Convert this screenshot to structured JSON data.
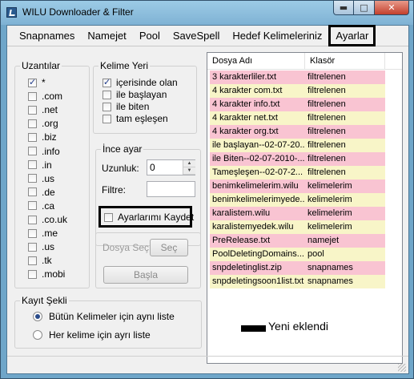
{
  "window": {
    "title": "WILU Downloader & Filter"
  },
  "menu": [
    "Snapnames",
    "Namejet",
    "Pool",
    "SaveSpell",
    "Hedef Kelimeleriniz",
    "Ayarlar"
  ],
  "extensions": {
    "legend": "Uzantılar",
    "items": [
      {
        "label": "*",
        "checked": true
      },
      {
        "label": ".com",
        "checked": false
      },
      {
        "label": ".net",
        "checked": false
      },
      {
        "label": ".org",
        "checked": false
      },
      {
        "label": ".biz",
        "checked": false
      },
      {
        "label": ".info",
        "checked": false
      },
      {
        "label": ".in",
        "checked": false
      },
      {
        "label": ".us",
        "checked": false
      },
      {
        "label": ".de",
        "checked": false
      },
      {
        "label": ".ca",
        "checked": false
      },
      {
        "label": ".co.uk",
        "checked": false
      },
      {
        "label": ".me",
        "checked": false
      },
      {
        "label": ".us",
        "checked": false
      },
      {
        "label": ".tk",
        "checked": false
      },
      {
        "label": ".mobi",
        "checked": false
      }
    ]
  },
  "word_position": {
    "legend": "Kelime Yeri",
    "items": [
      {
        "label": "içerisinde olan",
        "checked": true
      },
      {
        "label": "ile başlayan",
        "checked": false
      },
      {
        "label": "ile biten",
        "checked": false
      },
      {
        "label": "tam eşleşen",
        "checked": false
      }
    ]
  },
  "fine_tune": {
    "legend": "İnce ayar",
    "length_label": "Uzunluk:",
    "length_value": "0",
    "filter_label": "Filtre:",
    "filter_value": ""
  },
  "save_settings": {
    "label": "Ayarlarımı Kaydet",
    "checked": false
  },
  "file_select": {
    "label": "Dosya Seç",
    "button": "Seç"
  },
  "start_button": "Başla",
  "save_mode": {
    "legend": "Kayıt Şekli",
    "options": [
      {
        "label": "Bütün Kelimeler için aynı liste",
        "selected": true
      },
      {
        "label": "Her kelime için ayrı liste",
        "selected": false
      }
    ]
  },
  "file_list": {
    "columns": [
      "Dosya Adı",
      "Klasör"
    ],
    "rows": [
      {
        "name": "3 karakterliler.txt",
        "folder": "filtrelenen",
        "color": "pink"
      },
      {
        "name": "4 karakter com.txt",
        "folder": "filtrelenen",
        "color": "yellow"
      },
      {
        "name": "4 karakter info.txt",
        "folder": "filtrelenen",
        "color": "pink"
      },
      {
        "name": "4 karakter net.txt",
        "folder": "filtrelenen",
        "color": "yellow"
      },
      {
        "name": "4 karakter org.txt",
        "folder": "filtrelenen",
        "color": "pink"
      },
      {
        "name": "ile başlayan--02-07-20...",
        "folder": "filtrelenen",
        "color": "yellow"
      },
      {
        "name": "ile Biten--02-07-2010-...",
        "folder": "filtrelenen",
        "color": "pink"
      },
      {
        "name": "Tameşleşen--02-07-2...",
        "folder": "filtrelenen",
        "color": "yellow"
      },
      {
        "name": "benimkelimelerim.wilu",
        "folder": "kelimelerim",
        "color": "pink"
      },
      {
        "name": "benimkelimelerimyede...",
        "folder": "kelimelerim",
        "color": "yellow"
      },
      {
        "name": "karalistem.wilu",
        "folder": "kelimelerim",
        "color": "pink"
      },
      {
        "name": "karalistemyedek.wilu",
        "folder": "kelimelerim",
        "color": "yellow"
      },
      {
        "name": "PreRelease.txt",
        "folder": "namejet",
        "color": "pink"
      },
      {
        "name": "PoolDeletingDomains...",
        "folder": "pool",
        "color": "yellow"
      },
      {
        "name": "snpdeletinglist.zip",
        "folder": "snapnames",
        "color": "pink"
      },
      {
        "name": "snpdeletingsoon1list.txt",
        "folder": "snapnames",
        "color": "yellow"
      }
    ]
  },
  "annotation": {
    "text": "Yeni eklendi"
  },
  "colors": {
    "pink": "#f9c4d2",
    "yellow": "#f8f5c8",
    "highlight_border": "#000000"
  }
}
